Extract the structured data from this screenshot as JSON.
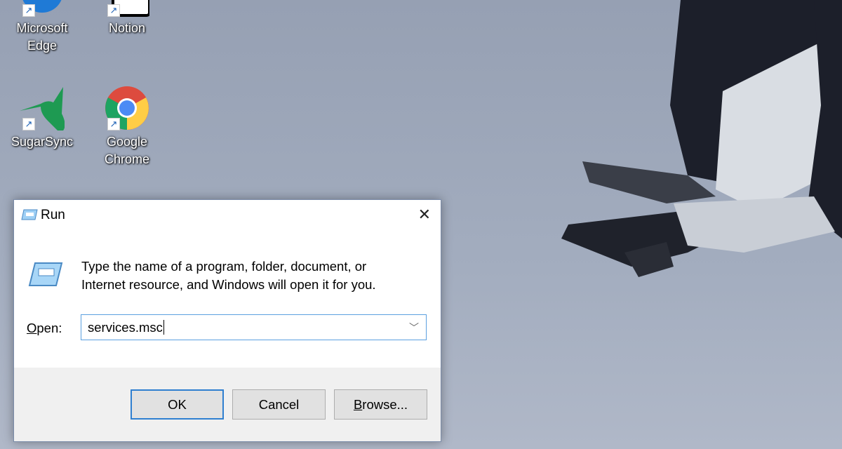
{
  "desktop": {
    "icons": [
      {
        "label_lines": [
          "Microsoft",
          "Edge"
        ],
        "icon": "edge-icon"
      },
      {
        "label_lines": [
          "Notion"
        ],
        "icon": "notion-icon"
      },
      {
        "label_lines": [
          "SugarSync"
        ],
        "icon": "sugarsync-icon"
      },
      {
        "label_lines": [
          "Google",
          "Chrome"
        ],
        "icon": "chrome-icon"
      }
    ]
  },
  "dialog": {
    "title": "Run",
    "description_line1": "Type the name of a program, folder, document, or",
    "description_line2": "Internet resource, and Windows will open it for you.",
    "open_label_access": "O",
    "open_label_rest": "pen:",
    "open_value": "services.msc",
    "ok_label": "OK",
    "cancel_label": "Cancel",
    "browse_access": "B",
    "browse_rest": "rowse..."
  }
}
